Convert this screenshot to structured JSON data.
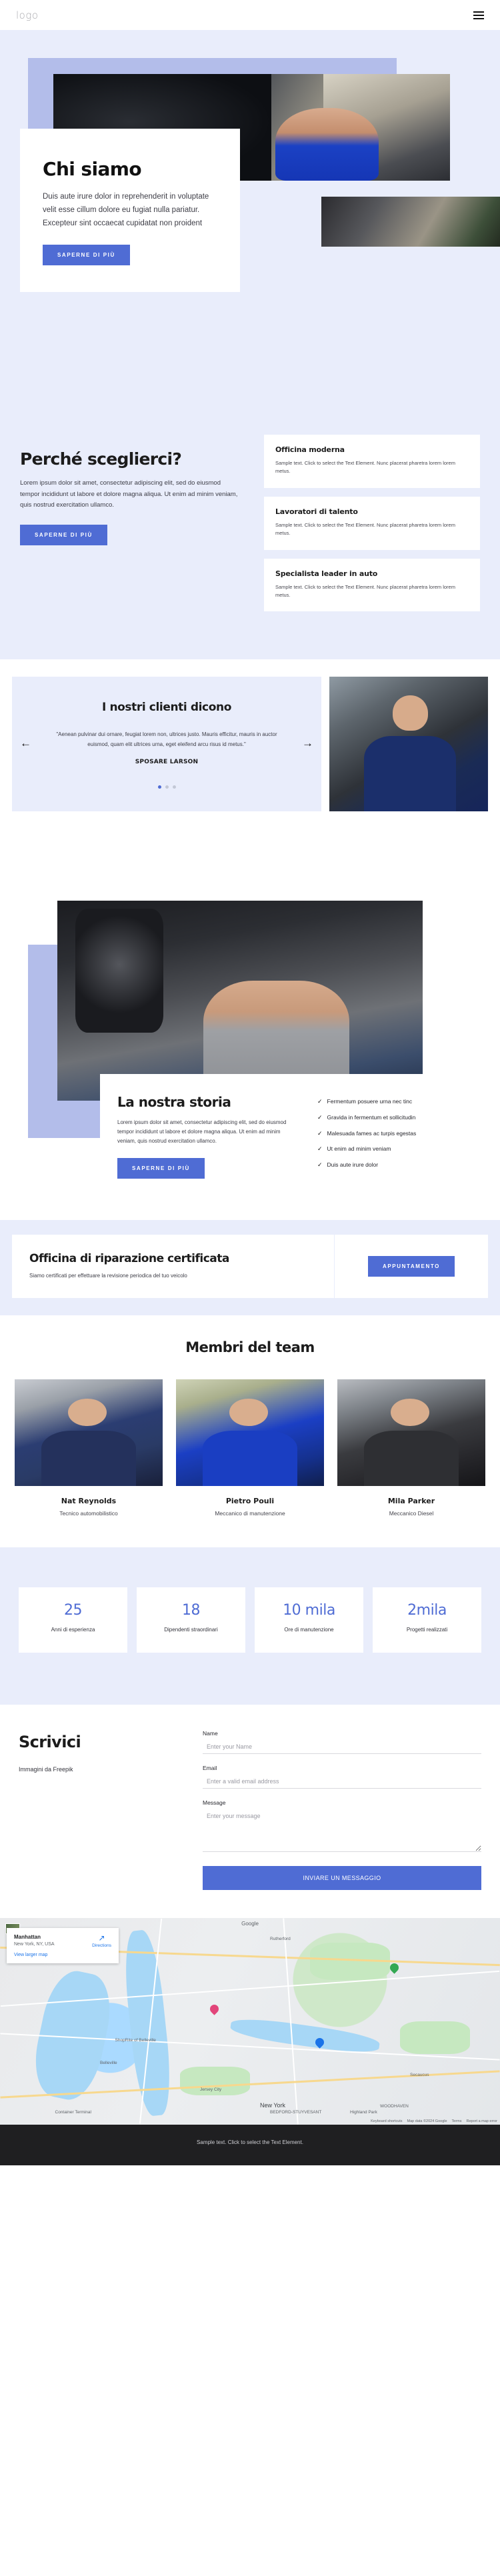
{
  "header": {
    "logo": "logo",
    "menu_icon": "hamburger-menu"
  },
  "hero": {
    "title": "Chi siamo",
    "body": "Duis aute irure dolor in reprehenderit in voluptate velit esse cillum dolore eu fugiat nulla pariatur. Excepteur sint occaecat cupidatat non proident",
    "cta": "SAPERNE DI PIÙ"
  },
  "why": {
    "title": "Perché sceglierci?",
    "body": "Lorem ipsum dolor sit amet, consectetur adipiscing elit, sed do eiusmod tempor incididunt ut labore et dolore magna aliqua. Ut enim ad minim veniam, quis nostrud exercitation ullamco.",
    "cta": "SAPERNE DI PIÙ",
    "cards": [
      {
        "title": "Officina moderna",
        "body": "Sample text. Click to select the Text Element. Nunc placerat pharetra lorem lorem metus."
      },
      {
        "title": "Lavoratori di talento",
        "body": "Sample text. Click to select the Text Element. Nunc placerat pharetra lorem lorem metus."
      },
      {
        "title": "Specialista leader in auto",
        "body": "Sample text. Click to select the Text Element. Nunc placerat pharetra lorem lorem metus."
      }
    ]
  },
  "testimonials": {
    "title": "I nostri clienti dicono",
    "quote": "\"Aenean pulvinar dui ornare, feugiat lorem non, ultrices justo. Mauris efficitur, mauris in auctor euismod, quam elit ultrices urna, eget eleifend arcu risus id metus.\"",
    "author": "SPOSARE LARSON",
    "prev_icon": "arrow-left-icon",
    "next_icon": "arrow-right-icon",
    "dots": 3,
    "active_dot": 0
  },
  "story": {
    "title": "La nostra storia",
    "body": "Lorem ipsum dolor sit amet, consectetur adipiscing elit, sed do eiusmod tempor incididunt ut labore et dolore magna aliqua. Ut enim ad minim veniam, quis nostrud exercitation ullamco.",
    "cta": "SAPERNE DI PIÙ",
    "checklist": [
      "Fermentum posuere urna nec tinc",
      "Gravida in fermentum et sollicitudin",
      "Malesuada fames ac turpis egestas",
      "Ut enim ad minim veniam",
      "Duis aute irure dolor"
    ]
  },
  "cert": {
    "title": "Officina di riparazione certificata",
    "subtitle": "Siamo certificati per effettuare la revisione periodica del tuo veicolo",
    "cta": "APPUNTAMENTO"
  },
  "team": {
    "title": "Membri del team",
    "members": [
      {
        "name": "Nat Reynolds",
        "role": "Tecnico automobilistico"
      },
      {
        "name": "Pietro Pouli",
        "role": "Meccanico di manutenzione"
      },
      {
        "name": "Mila Parker",
        "role": "Meccanico Diesel"
      }
    ]
  },
  "stats": [
    {
      "value": "25",
      "label": "Anni di esperienza"
    },
    {
      "value": "18",
      "label": "Dipendenti straordinari"
    },
    {
      "value": "10 mila",
      "label": "Ore di manutenzione"
    },
    {
      "value": "2mila",
      "label": "Progetti realizzati"
    }
  ],
  "contact": {
    "title": "Scrivici",
    "credit": "Immagini da Freepik",
    "name_label": "Name",
    "name_placeholder": "Enter your Name",
    "email_label": "Email",
    "email_placeholder": "Enter a valid email address",
    "message_label": "Message",
    "message_placeholder": "Enter your message",
    "submit": "INVIARE UN MESSAGGIO"
  },
  "map": {
    "card_title": "Manhattan",
    "card_sub": "New York, NY, USA",
    "card_link": "View larger map",
    "directions_label": "Directions",
    "directions_icon": "directions-arrow-icon",
    "brand": "Google",
    "labels": [
      "Rutherford",
      "Belleville",
      "ShopRite of Belleville",
      "Secaucus",
      "Jersey City",
      "New York",
      "Highland Park",
      "WOODHAVEN",
      "BEDFORD-STUYVESANT",
      "Container Terminal"
    ],
    "attributions": [
      "Keyboard shortcuts",
      "Map data ©2024 Google",
      "Terms",
      "Report a map error"
    ]
  },
  "footer": {
    "text": "Sample text. Click to select the Text Element."
  },
  "colors": {
    "accent": "#4f6cd4",
    "accent_light": "#b3bdea",
    "section_bg": "#e9edfb",
    "footer_bg": "#1f1f21"
  }
}
